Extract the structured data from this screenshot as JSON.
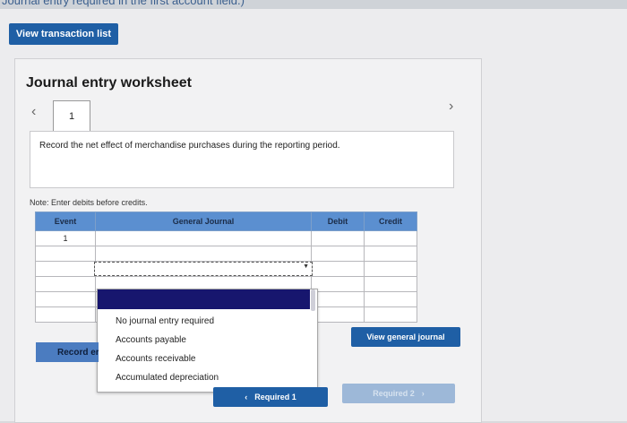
{
  "top_strip_text": "Journal entry required in the first account field.)",
  "view_transaction_list": "View transaction list",
  "worksheet": {
    "title": "Journal entry worksheet",
    "prev_icon": "‹",
    "next_icon": "›",
    "tab_number": "1",
    "description": "Record the net effect of merchandise purchases during the reporting period.",
    "note": "Note: Enter debits before credits."
  },
  "table": {
    "headers": {
      "event": "Event",
      "account": "General Journal",
      "debit": "Debit",
      "credit": "Credit"
    },
    "rows": [
      {
        "event": "1",
        "account": "",
        "debit": "",
        "credit": ""
      },
      {
        "event": "",
        "account": "",
        "debit": "",
        "credit": ""
      },
      {
        "event": "",
        "account": "",
        "debit": "",
        "credit": ""
      },
      {
        "event": "",
        "account": "",
        "debit": "",
        "credit": ""
      },
      {
        "event": "",
        "account": "",
        "debit": "",
        "credit": ""
      },
      {
        "event": "",
        "account": "",
        "debit": "",
        "credit": ""
      }
    ]
  },
  "dropdown": {
    "options": [
      "No journal entry required",
      "Accounts payable",
      "Accounts receivable",
      "Accumulated depreciation"
    ]
  },
  "record_entry_label": "Record er",
  "view_general_journal": "View general journal",
  "bottom": {
    "prev_label": "Required 1",
    "next_label": "Required 2"
  },
  "colors": {
    "accent_blue": "#1f5fa5",
    "header_blue": "#5b8fd0",
    "selected_option": "#17166e"
  }
}
